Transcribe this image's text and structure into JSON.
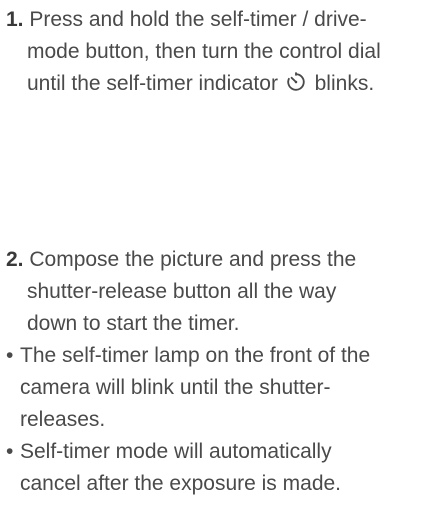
{
  "steps": [
    {
      "number": "1.",
      "lines": [
        "Press and hold the self-timer / drive-",
        "mode button, then turn the control dial",
        "until the self-timer indicator",
        "blinks."
      ]
    },
    {
      "number": "2.",
      "lines": [
        "Compose the picture and press the",
        "shutter-release button all the way",
        "down to start the timer."
      ]
    }
  ],
  "bullets": [
    {
      "marker": "•",
      "lines": [
        "The self-timer lamp on the front of the",
        "camera will blink until the shutter-",
        "releases."
      ]
    },
    {
      "marker": "•",
      "lines": [
        "Self-timer mode will automatically",
        "cancel after the exposure is made."
      ]
    }
  ],
  "icons": {
    "self_timer": "self-timer-icon"
  }
}
